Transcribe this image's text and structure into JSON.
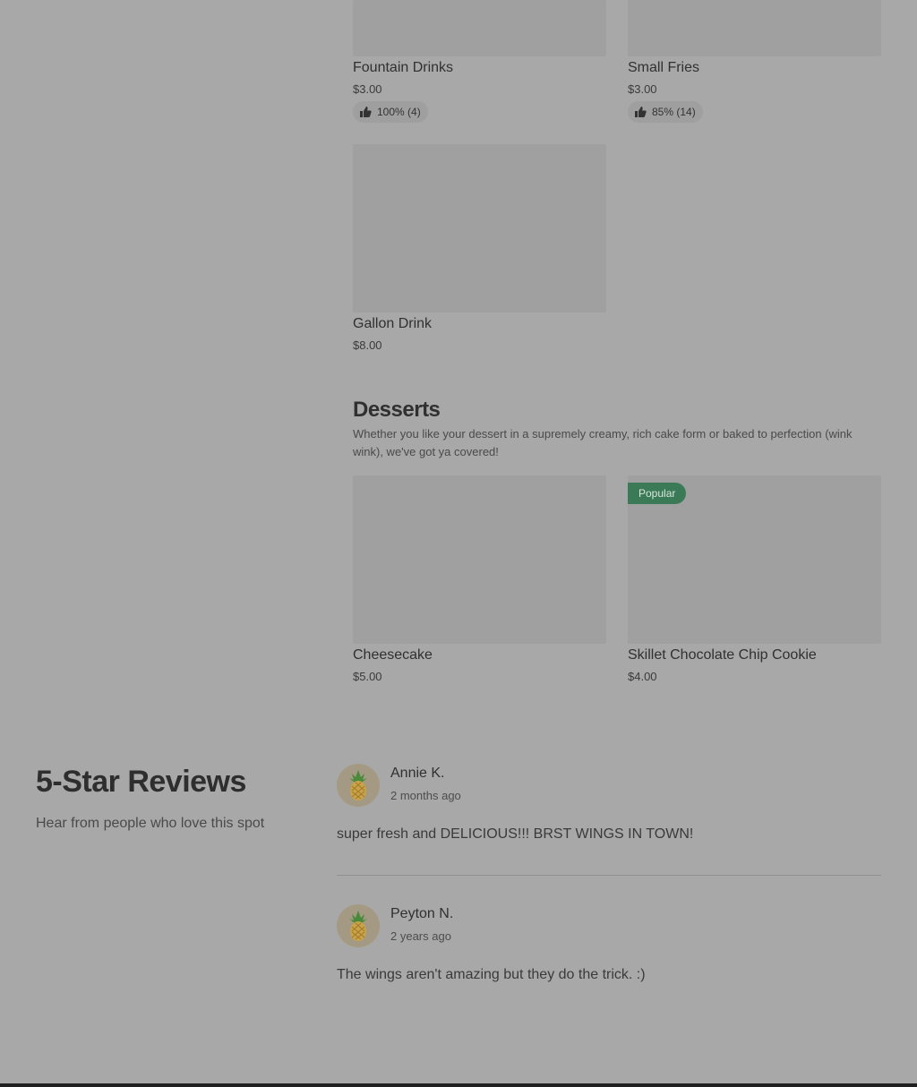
{
  "menu": {
    "items_top": [
      {
        "name": "Fountain Drinks",
        "price": "$3.00",
        "rating": "100% (4)"
      },
      {
        "name": "Small Fries",
        "price": "$3.00",
        "rating": "85% (14)"
      }
    ],
    "gallon": {
      "name": "Gallon Drink",
      "price": "$8.00"
    }
  },
  "desserts": {
    "title": "Desserts",
    "description": "Whether you like your dessert in a supremely creamy, rich cake form or baked to perfection (wink wink), we've got ya covered!",
    "items": [
      {
        "name": "Cheesecake",
        "price": "$5.00"
      },
      {
        "name": "Skillet Chocolate Chip Cookie",
        "price": "$4.00",
        "badge": "Popular"
      }
    ]
  },
  "reviews": {
    "title": "5-Star Reviews",
    "subtitle": "Hear from people who love this spot",
    "list": [
      {
        "name": "Annie K.",
        "time": "2 months ago",
        "text": "super fresh and DELICIOUS!!! BRST WINGS IN TOWN!"
      },
      {
        "name": "Peyton N.",
        "time": "2 years ago",
        "text": "The wings aren't amazing but they do the trick. :)"
      }
    ]
  },
  "icons": {
    "rating": "thumbs-up-icon",
    "avatar": "pineapple-icon"
  },
  "colors": {
    "popular_badge": "#3b7a57",
    "overlay_bg": "#a8a8a8"
  }
}
